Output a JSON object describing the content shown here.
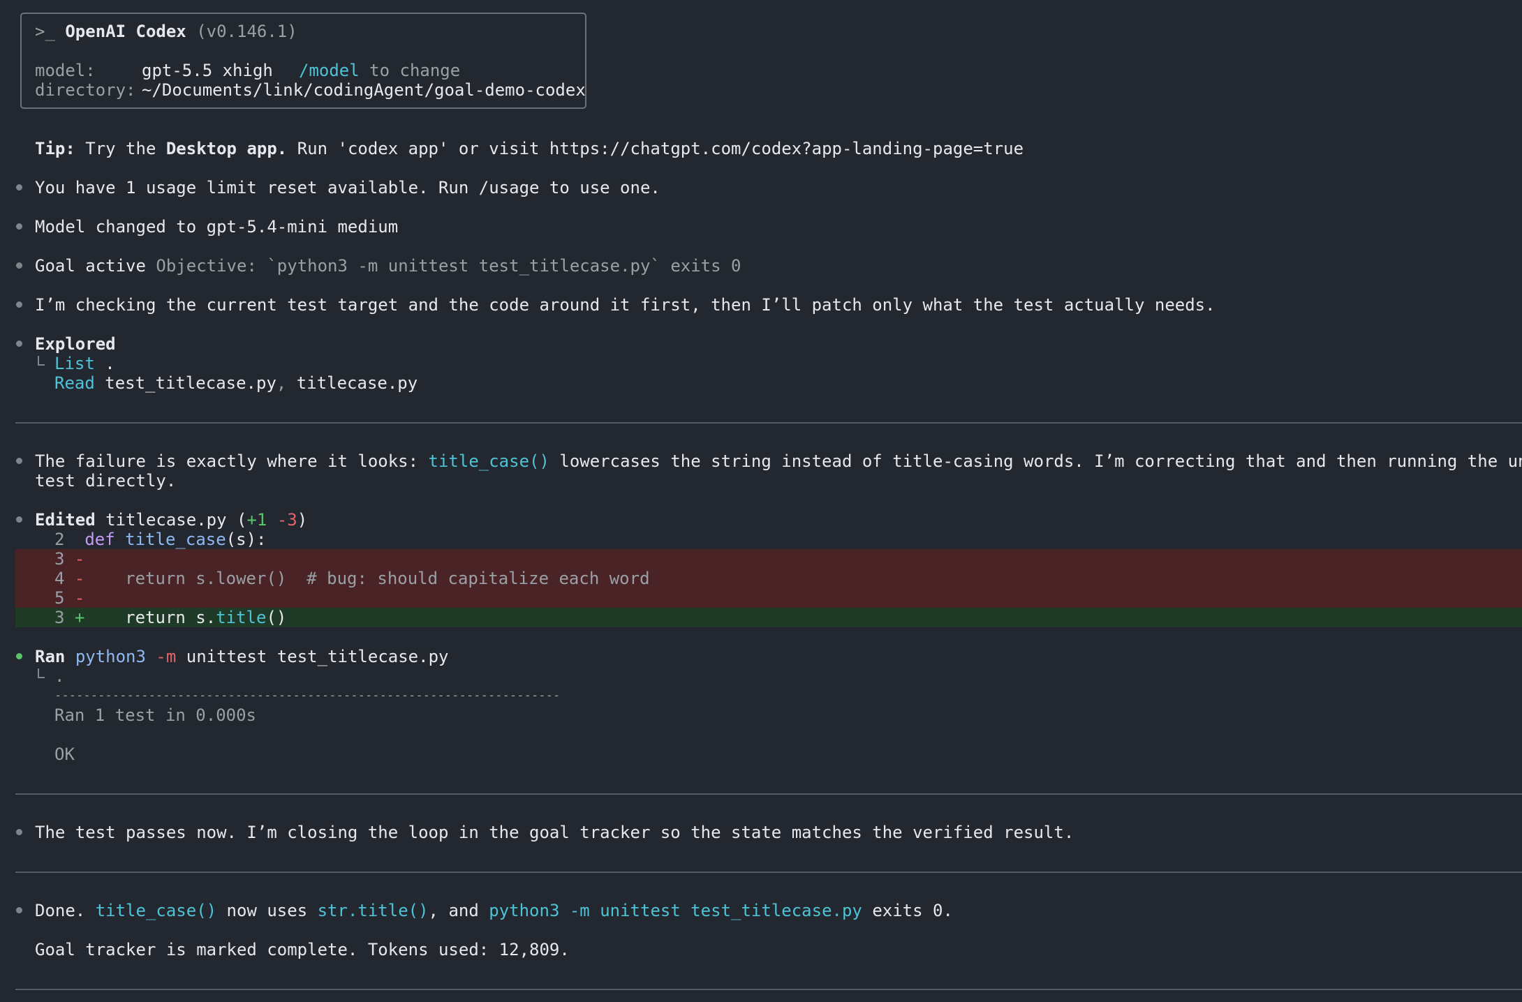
{
  "header": {
    "prompt": ">_",
    "app_name": "OpenAI Codex",
    "version": "(v0.146.1)",
    "model_label": "model:",
    "model_value": "gpt-5.5 xhigh",
    "model_cmd": "/model",
    "model_hint": "to change",
    "dir_label": "directory:",
    "dir_value": "~/Documents/link/codingAgent/goal-demo-codex"
  },
  "tip": {
    "label": "Tip:",
    "pre": "Try the",
    "app": "Desktop app.",
    "post": "Run 'codex app' or visit https://chatgpt.com/codex?app-landing-page=true"
  },
  "messages": {
    "usage": "You have 1 usage limit reset available. Run /usage to use one.",
    "model_changed": "Model changed to gpt-5.4-mini medium",
    "goal_label": "Goal active",
    "goal_objective": "Objective: `python3 -m unittest test_titlecase.py` exits 0",
    "checking": "I’m checking the current test target and the code around it first, then I’ll patch only what the test actually needs."
  },
  "explored": {
    "title": "Explored",
    "list_verb": "List",
    "list_arg": ".",
    "read_verb": "Read",
    "read_file1": "test_titlecase.py",
    "read_sep": ",",
    "read_file2": "titlecase.py"
  },
  "failure": {
    "pre": "The failure is exactly where it looks:",
    "func": "title_case()",
    "post": "lowercases the string instead of title-casing words. I’m correcting that and then running the unit",
    "line2": "test directly."
  },
  "edited": {
    "title": "Edited",
    "file": "titlecase.py",
    "open": "(",
    "added": "+1",
    "removed": "-3",
    "close": ")",
    "lines": [
      {
        "num": "2",
        "sign": "",
        "kw": "def",
        "name": "title_case",
        "rest": "(s):"
      },
      {
        "num": "3",
        "sign": "-",
        "code": ""
      },
      {
        "num": "4",
        "sign": "-",
        "code": "    return s.lower()  # bug: should capitalize each word"
      },
      {
        "num": "5",
        "sign": "-",
        "code": ""
      },
      {
        "num": "3",
        "sign": "+",
        "code_a": "    return s.",
        "code_b": "title",
        "code_c": "()"
      }
    ]
  },
  "ran": {
    "title": "Ran",
    "cmd": "python3",
    "flag": "-m",
    "args": "unittest test_titlecase.py",
    "out_dot": ".",
    "out_rule": "----------------------------------------------------------------------",
    "out_result": "Ran 1 test in 0.000s",
    "out_ok": "OK"
  },
  "passes": "The test passes now. I’m closing the loop in the goal tracker so the state matches the verified result.",
  "done": {
    "pre": "Done.",
    "func": "title_case()",
    "mid1": "now uses",
    "method": "str.title()",
    "mid2": ", and",
    "cmd": "python3 -m unittest test_titlecase.py",
    "post": "exits 0.",
    "line2": "Goal tracker is marked complete. Tokens used: 12,809."
  }
}
